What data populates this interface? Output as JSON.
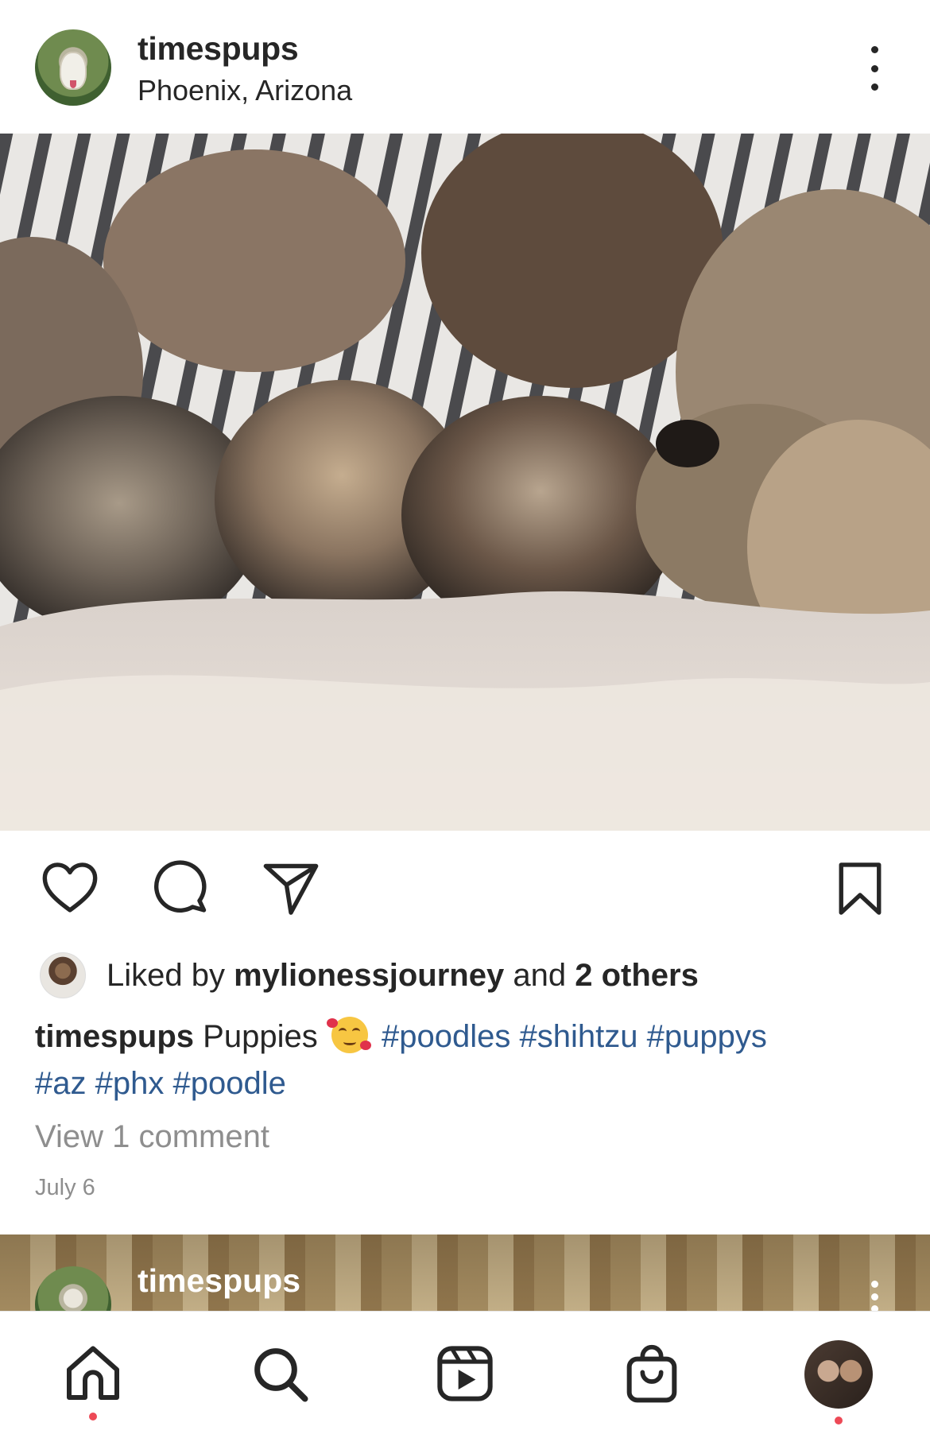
{
  "post": {
    "username": "timespups",
    "location": "Phoenix, Arizona",
    "photo_icon": "puppies-photo",
    "likes": {
      "prefix": "Liked by",
      "liker": "mylionessjourney",
      "connector": "and",
      "others": "2 others"
    },
    "caption": {
      "username": "timespups",
      "text": "Puppies",
      "emoji": "smiling-face-with-hearts",
      "tags": [
        "#poodles",
        "#shihtzu",
        "#puppys",
        "#az",
        "#phx",
        "#poodle"
      ]
    },
    "view_comments": "View 1 comment",
    "date": "July 6"
  },
  "actions": {
    "like_icon": "heart-icon",
    "comment_icon": "comment-icon",
    "share_icon": "send-icon",
    "save_icon": "bookmark-icon"
  },
  "next_post": {
    "username": "timespups"
  },
  "bottom_nav": {
    "items": [
      "home-icon",
      "search-icon",
      "reels-icon",
      "shop-icon",
      "profile-avatar"
    ],
    "notification_color": "#ed4956"
  },
  "colors": {
    "text": "#262626",
    "hashtag": "#2f5a8f",
    "muted": "#8e8e8e"
  }
}
